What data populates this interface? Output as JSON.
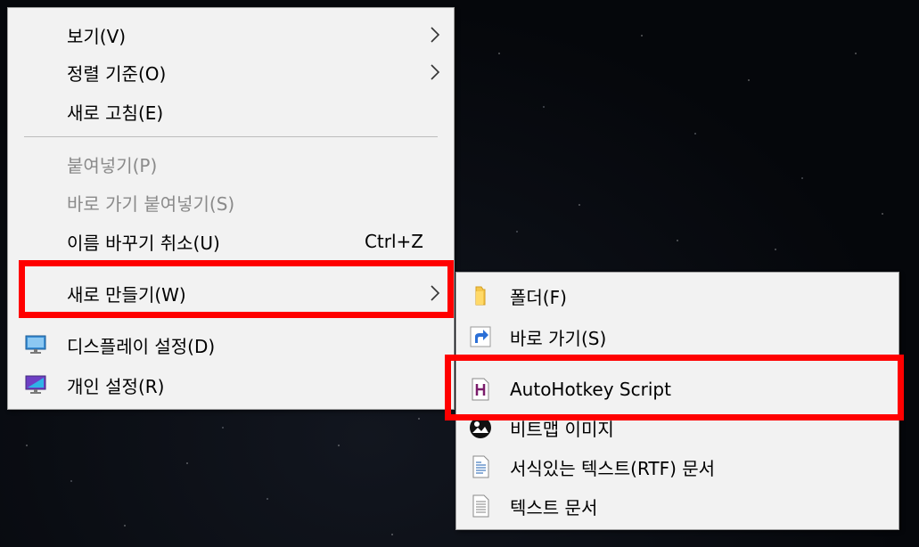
{
  "main_menu": {
    "items": [
      {
        "label": "보기(V)"
      },
      {
        "label": "정렬 기준(O)"
      },
      {
        "label": "새로 고침(E)"
      },
      {
        "label": "붙여넣기(P)"
      },
      {
        "label": "바로 가기 붙여넣기(S)"
      },
      {
        "label": "이름 바꾸기 취소(U)",
        "shortcut": "Ctrl+Z"
      },
      {
        "label": "새로 만들기(W)"
      },
      {
        "label": "디스플레이 설정(D)",
        "icon": "display-icon"
      },
      {
        "label": "개인 설정(R)",
        "icon": "personalize-icon"
      }
    ]
  },
  "sub_menu": {
    "items": [
      {
        "label": "폴더(F)",
        "icon": "folder-icon"
      },
      {
        "label": "바로 가기(S)",
        "icon": "shortcut-icon"
      },
      {
        "label": "AutoHotkey Script",
        "icon": "autohotkey-icon"
      },
      {
        "label": "비트맵 이미지",
        "icon": "bitmap-icon"
      },
      {
        "label": "서식있는 텍스트(RTF) 문서",
        "icon": "rtf-document-icon"
      },
      {
        "label": "텍스트 문서",
        "icon": "text-document-icon"
      }
    ]
  },
  "colors": {
    "highlight": "#ff0000",
    "menu_bg": "#f2f2f2",
    "disabled_text": "#8a8a8a"
  }
}
